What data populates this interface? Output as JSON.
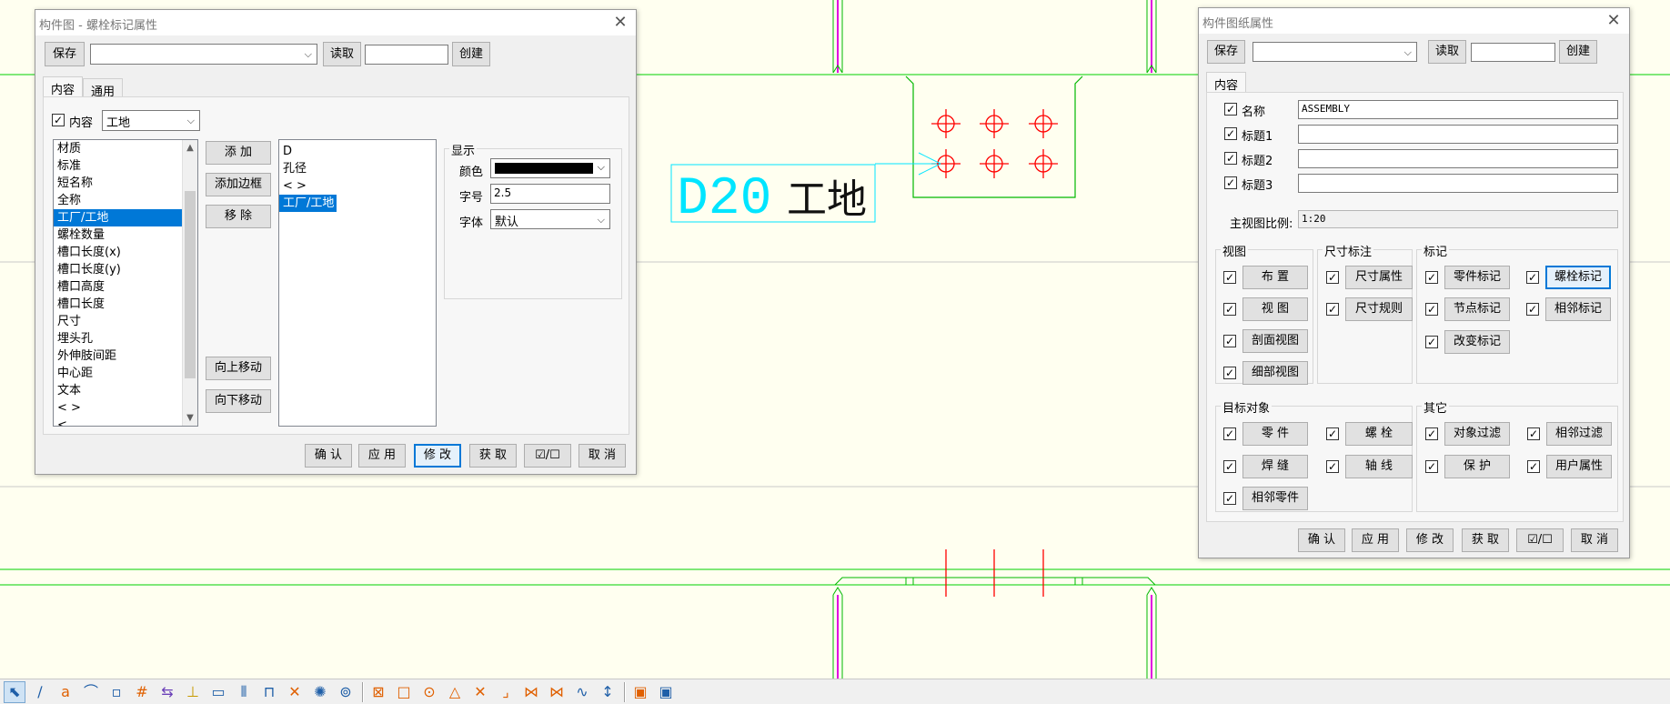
{
  "drawing": {
    "bolt_mark_text": "D20",
    "bolt_site_text": "工地"
  },
  "colors": {
    "background": "#fffff0",
    "guide_line": "#00d000",
    "part_line": "#00b800",
    "bolt_symbol": "#ff0000",
    "mark_text": "#00e5ff",
    "profile_accent": "#e000e0",
    "dialog_bg": "#f0f0f0",
    "highlight": "#0078d7"
  },
  "left_dialog": {
    "title": "构件图 - 螺栓标记属性",
    "save_label": "保存",
    "preset_value": "",
    "load_label": "读取",
    "new_name_value": "",
    "create_label": "创建",
    "tabs": [
      "内容",
      "通用"
    ],
    "content_checkbox": "内容",
    "content_checked": true,
    "location_value": "工地",
    "available_items": [
      "材质",
      "标准",
      "短名称",
      "全称",
      "工厂/工地",
      "螺栓数量",
      "槽口长度(x)",
      "槽口长度(y)",
      "槽口高度",
      "槽口长度",
      "尺寸",
      "埋头孔",
      "外伸肢间距",
      "中心距",
      "文本",
      "< >",
      "< ..."
    ],
    "available_selected_index": 4,
    "add_label": "添 加",
    "add_frame_label": "添加边框",
    "remove_label": "移 除",
    "move_up_label": "向上移动",
    "move_down_label": "向下移动",
    "selected_items": [
      "D",
      "孔径",
      "< >",
      "工厂/工地"
    ],
    "selected_selected_index": 3,
    "display_group": "显示",
    "color_label": "颜色",
    "color_value": "#000000",
    "size_label": "字号",
    "size_value": "2.5",
    "font_label": "字体",
    "font_value": "默认",
    "footer": {
      "ok": "确 认",
      "apply": "应 用",
      "modify": "修 改",
      "get": "获 取",
      "toggle": "☑/☐",
      "cancel": "取 消"
    }
  },
  "right_dialog": {
    "title": "构件图纸属性",
    "save_label": "保存",
    "preset_value": "",
    "load_label": "读取",
    "new_name_value": "",
    "create_label": "创建",
    "tab": "内容",
    "fields": [
      {
        "label": "名称",
        "value": "ASSEMBLY",
        "checked": true
      },
      {
        "label": "标题1",
        "value": "",
        "checked": true
      },
      {
        "label": "标题2",
        "value": "",
        "checked": true
      },
      {
        "label": "标题3",
        "value": "",
        "checked": true
      }
    ],
    "scale_label": "主视图比例:",
    "scale_value": "1:20",
    "views_group": "视图",
    "views": [
      "布 置",
      "视 图",
      "剖面视图",
      "细部视图"
    ],
    "dims_group": "尺寸标注",
    "dims": [
      "尺寸属性",
      "尺寸规则"
    ],
    "marks_group": "标记",
    "marks": [
      "零件标记",
      "螺栓标记",
      "节点标记",
      "相邻标记",
      "改变标记"
    ],
    "objects_group": "目标对象",
    "objects": [
      "零 件",
      "螺 栓",
      "焊 缝",
      "轴 线",
      "相邻零件"
    ],
    "others_group": "其它",
    "others": [
      "对象过滤",
      "相邻过滤",
      "保 护",
      "用户属性"
    ],
    "footer": {
      "ok": "确 认",
      "apply": "应 用",
      "modify": "修 改",
      "get": "获 取",
      "toggle": "☑/☐",
      "cancel": "取 消"
    }
  },
  "toolbar": {
    "icons": [
      "select-icon",
      "polyline-icon",
      "text-icon",
      "arc-icon",
      "rectangle-icon",
      "grid-snap-icon",
      "move-icon",
      "weld-icon",
      "frame-icon",
      "rebar-icon",
      "dimension-icon",
      "hatch-icon",
      "explode-icon",
      "link-icon",
      "snap-end-icon",
      "snap-box-icon",
      "snap-circle-icon",
      "snap-triangle-icon",
      "snap-cross-icon",
      "snap-perpendicular-icon",
      "snap-midpoint-icon",
      "snap-intersection-icon",
      "snap-line-icon",
      "snap-extension-icon",
      "snap-point-icon",
      "snap-any-icon"
    ]
  }
}
